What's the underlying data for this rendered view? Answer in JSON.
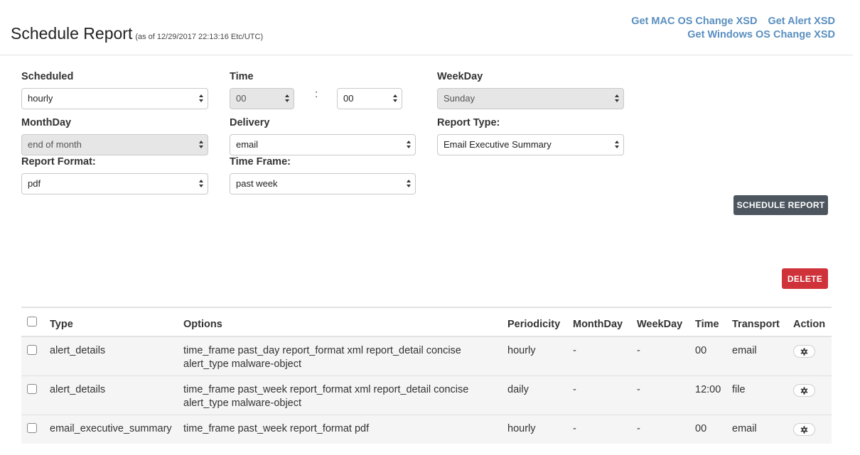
{
  "header": {
    "title": "Schedule Report",
    "subtitle": "(as of 12/29/2017 22:13:16 Etc/UTC)",
    "links": {
      "mac_xsd": "Get MAC OS Change XSD",
      "alert_xsd": "Get Alert XSD",
      "windows_xsd": "Get Windows OS Change XSD"
    }
  },
  "form": {
    "scheduled": {
      "label": "Scheduled",
      "value": "hourly"
    },
    "time": {
      "label": "Time",
      "hour": "00",
      "separator": ":",
      "minute": "00"
    },
    "weekday": {
      "label": "WeekDay",
      "value": "Sunday"
    },
    "monthday": {
      "label": "MonthDay",
      "value": "end of month"
    },
    "delivery": {
      "label": "Delivery",
      "value": "email"
    },
    "report_type": {
      "label": "Report Type:",
      "value": "Email Executive Summary"
    },
    "report_format": {
      "label": "Report Format:",
      "value": "pdf"
    },
    "time_frame": {
      "label": "Time Frame:",
      "value": "past week"
    }
  },
  "buttons": {
    "schedule": "SCHEDULE REPORT",
    "delete": "DELETE"
  },
  "table": {
    "headers": [
      "Type",
      "Options",
      "Periodicity",
      "MonthDay",
      "WeekDay",
      "Time",
      "Transport",
      "Action"
    ],
    "rows": [
      {
        "type": "alert_details",
        "options": "time_frame past_day report_format xml report_detail concise alert_type malware-object",
        "periodicity": "hourly",
        "monthday": "-",
        "weekday": "-",
        "time": "00",
        "transport": "email"
      },
      {
        "type": "alert_details",
        "options": "time_frame past_week report_format xml report_detail concise alert_type malware-object",
        "periodicity": "daily",
        "monthday": "-",
        "weekday": "-",
        "time": "12:00",
        "transport": "file"
      },
      {
        "type": "email_executive_summary",
        "options": "time_frame past_week report_format pdf",
        "periodicity": "hourly",
        "monthday": "-",
        "weekday": "-",
        "time": "00",
        "transport": "email"
      }
    ]
  },
  "icons": {
    "row_action": "gear-icon",
    "select_caret": "up-down-caret-icon"
  }
}
